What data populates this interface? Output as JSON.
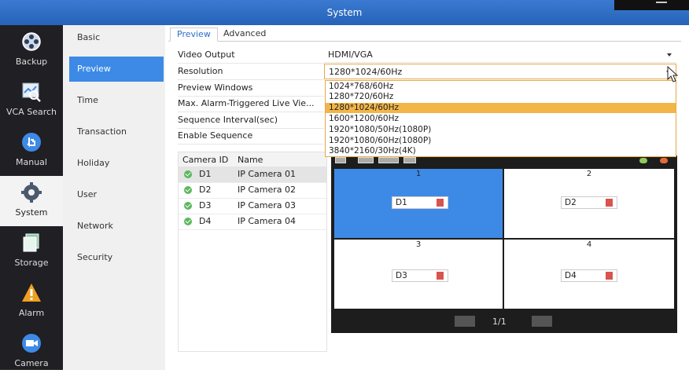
{
  "window": {
    "title": "System"
  },
  "rail": [
    {
      "label": "Backup",
      "icon": "backup-icon"
    },
    {
      "label": "VCA Search",
      "icon": "vca-search-icon"
    },
    {
      "label": "Manual",
      "icon": "manual-icon"
    },
    {
      "label": "System",
      "icon": "system-gear-icon"
    },
    {
      "label": "Storage",
      "icon": "storage-icon"
    },
    {
      "label": "Alarm",
      "icon": "alarm-icon"
    },
    {
      "label": "Camera",
      "icon": "camera-icon"
    }
  ],
  "submenu": [
    "Basic",
    "Preview",
    "Time",
    "Transaction",
    "Holiday",
    "User",
    "Network",
    "Security"
  ],
  "tabs": [
    "Preview",
    "Advanced"
  ],
  "form": {
    "video_output_label": "Video Output",
    "video_output_value": "HDMI/VGA",
    "resolution_label": "Resolution",
    "resolution_value": "1280*1024/60Hz",
    "preview_windows_label": "Preview Windows",
    "max_alarm_label": "Max. Alarm-Triggered Live Vie...",
    "sequence_interval_label": "Sequence Interval(sec)",
    "enable_sequence_label": "Enable Sequence"
  },
  "resolution_options": [
    "1024*768/60Hz",
    "1280*720/60Hz",
    "1280*1024/60Hz",
    "1600*1200/60Hz",
    "1920*1080/50Hz(1080P)",
    "1920*1080/60Hz(1080P)",
    "3840*2160/30Hz(4K)"
  ],
  "cameras": {
    "headers": {
      "id": "Camera ID",
      "name": "Name"
    },
    "rows": [
      {
        "id": "D1",
        "name": "IP Camera 01"
      },
      {
        "id": "D2",
        "name": "IP Camera 02"
      },
      {
        "id": "D3",
        "name": "IP Camera 03"
      },
      {
        "id": "D4",
        "name": "IP Camera 04"
      }
    ]
  },
  "preview": {
    "cells": [
      {
        "num": "1",
        "tag": "D1"
      },
      {
        "num": "2",
        "tag": "D2"
      },
      {
        "num": "3",
        "tag": "D3"
      },
      {
        "num": "4",
        "tag": "D4"
      }
    ],
    "page": "1/1"
  },
  "colors": {
    "accent": "#3d8ae6",
    "selected_option": "#f2b648",
    "rail_bg": "#1f1f24"
  }
}
